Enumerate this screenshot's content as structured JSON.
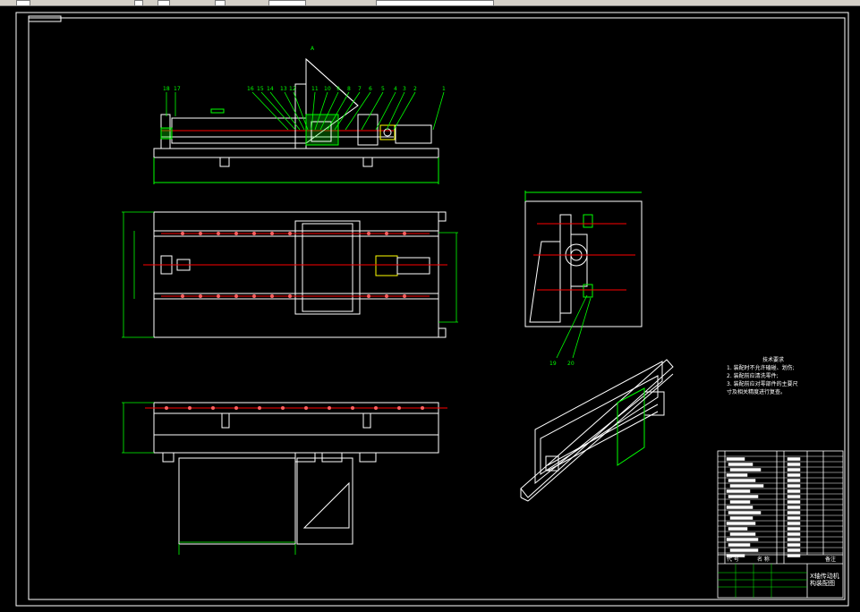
{
  "window": {
    "toolbar_items": [
      "file-icon",
      "dropdown-arrow-icon",
      "layer-icon",
      "color-icon",
      "linetype-icon",
      "lineweight-icon"
    ]
  },
  "drawing": {
    "background_color": "#000000",
    "line_color": "#ffffff",
    "dimension_color": "#00ff00",
    "center_color": "#ff0000",
    "accent_color": "#ffff00",
    "section_label": "A",
    "balloons_top": [
      "18",
      "17",
      "16",
      "15",
      "14",
      "13",
      "12",
      "11",
      "10",
      "9",
      "8",
      "7",
      "6",
      "5",
      "4",
      "3",
      "2",
      "1"
    ],
    "balloons_side": [
      "19",
      "20"
    ]
  },
  "notes": {
    "title": "技术要求",
    "items": [
      "1. 装配时不允许磕碰、划伤;",
      "2. 装配前应清洗零件;",
      "3. 装配前应对零部件的主要尺",
      "寸及相关精度进行复查。"
    ]
  },
  "title_block": {
    "name_line1": "X轴传动机",
    "name_line2": "构装配图",
    "col_code": "代 号",
    "col_name": "名 称",
    "col_note": "备注"
  }
}
